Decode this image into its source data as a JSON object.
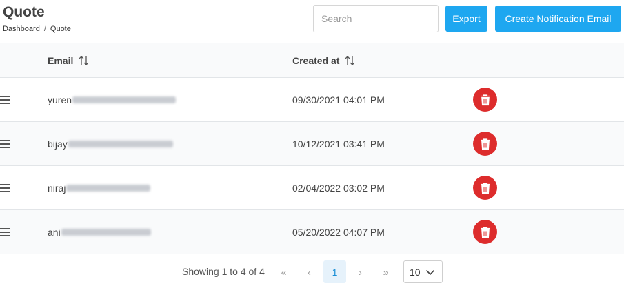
{
  "header": {
    "title": "Quote",
    "breadcrumb": [
      "Dashboard",
      "Quote"
    ],
    "breadcrumb_separator": "/"
  },
  "search": {
    "placeholder": "Search",
    "value": ""
  },
  "actions": {
    "export_label": "Export",
    "create_label": "Create Notification Email"
  },
  "table": {
    "columns": [
      {
        "label": "Email",
        "sortable": true
      },
      {
        "label": "Created at",
        "sortable": true
      }
    ],
    "rows": [
      {
        "email_visible": "yuren",
        "created_at": "09/30/2021 04:01 PM"
      },
      {
        "email_visible": "bijay",
        "created_at": "10/12/2021 03:41 PM"
      },
      {
        "email_visible": "niraj",
        "created_at": "02/04/2022 03:02 PM"
      },
      {
        "email_visible": "ani",
        "created_at": "05/20/2022 04:07 PM"
      }
    ],
    "row_actions": {
      "icon": "trash-icon",
      "color": "#dd2c2c"
    }
  },
  "pagination": {
    "summary": "Showing 1 to 4 of 4",
    "first": "«",
    "prev": "‹",
    "current_page": "1",
    "next": "›",
    "last": "»",
    "page_size": "10"
  },
  "colors": {
    "accent": "#1ea7f0",
    "danger": "#dd2c2c",
    "active_page_bg": "#e6f2fb"
  }
}
